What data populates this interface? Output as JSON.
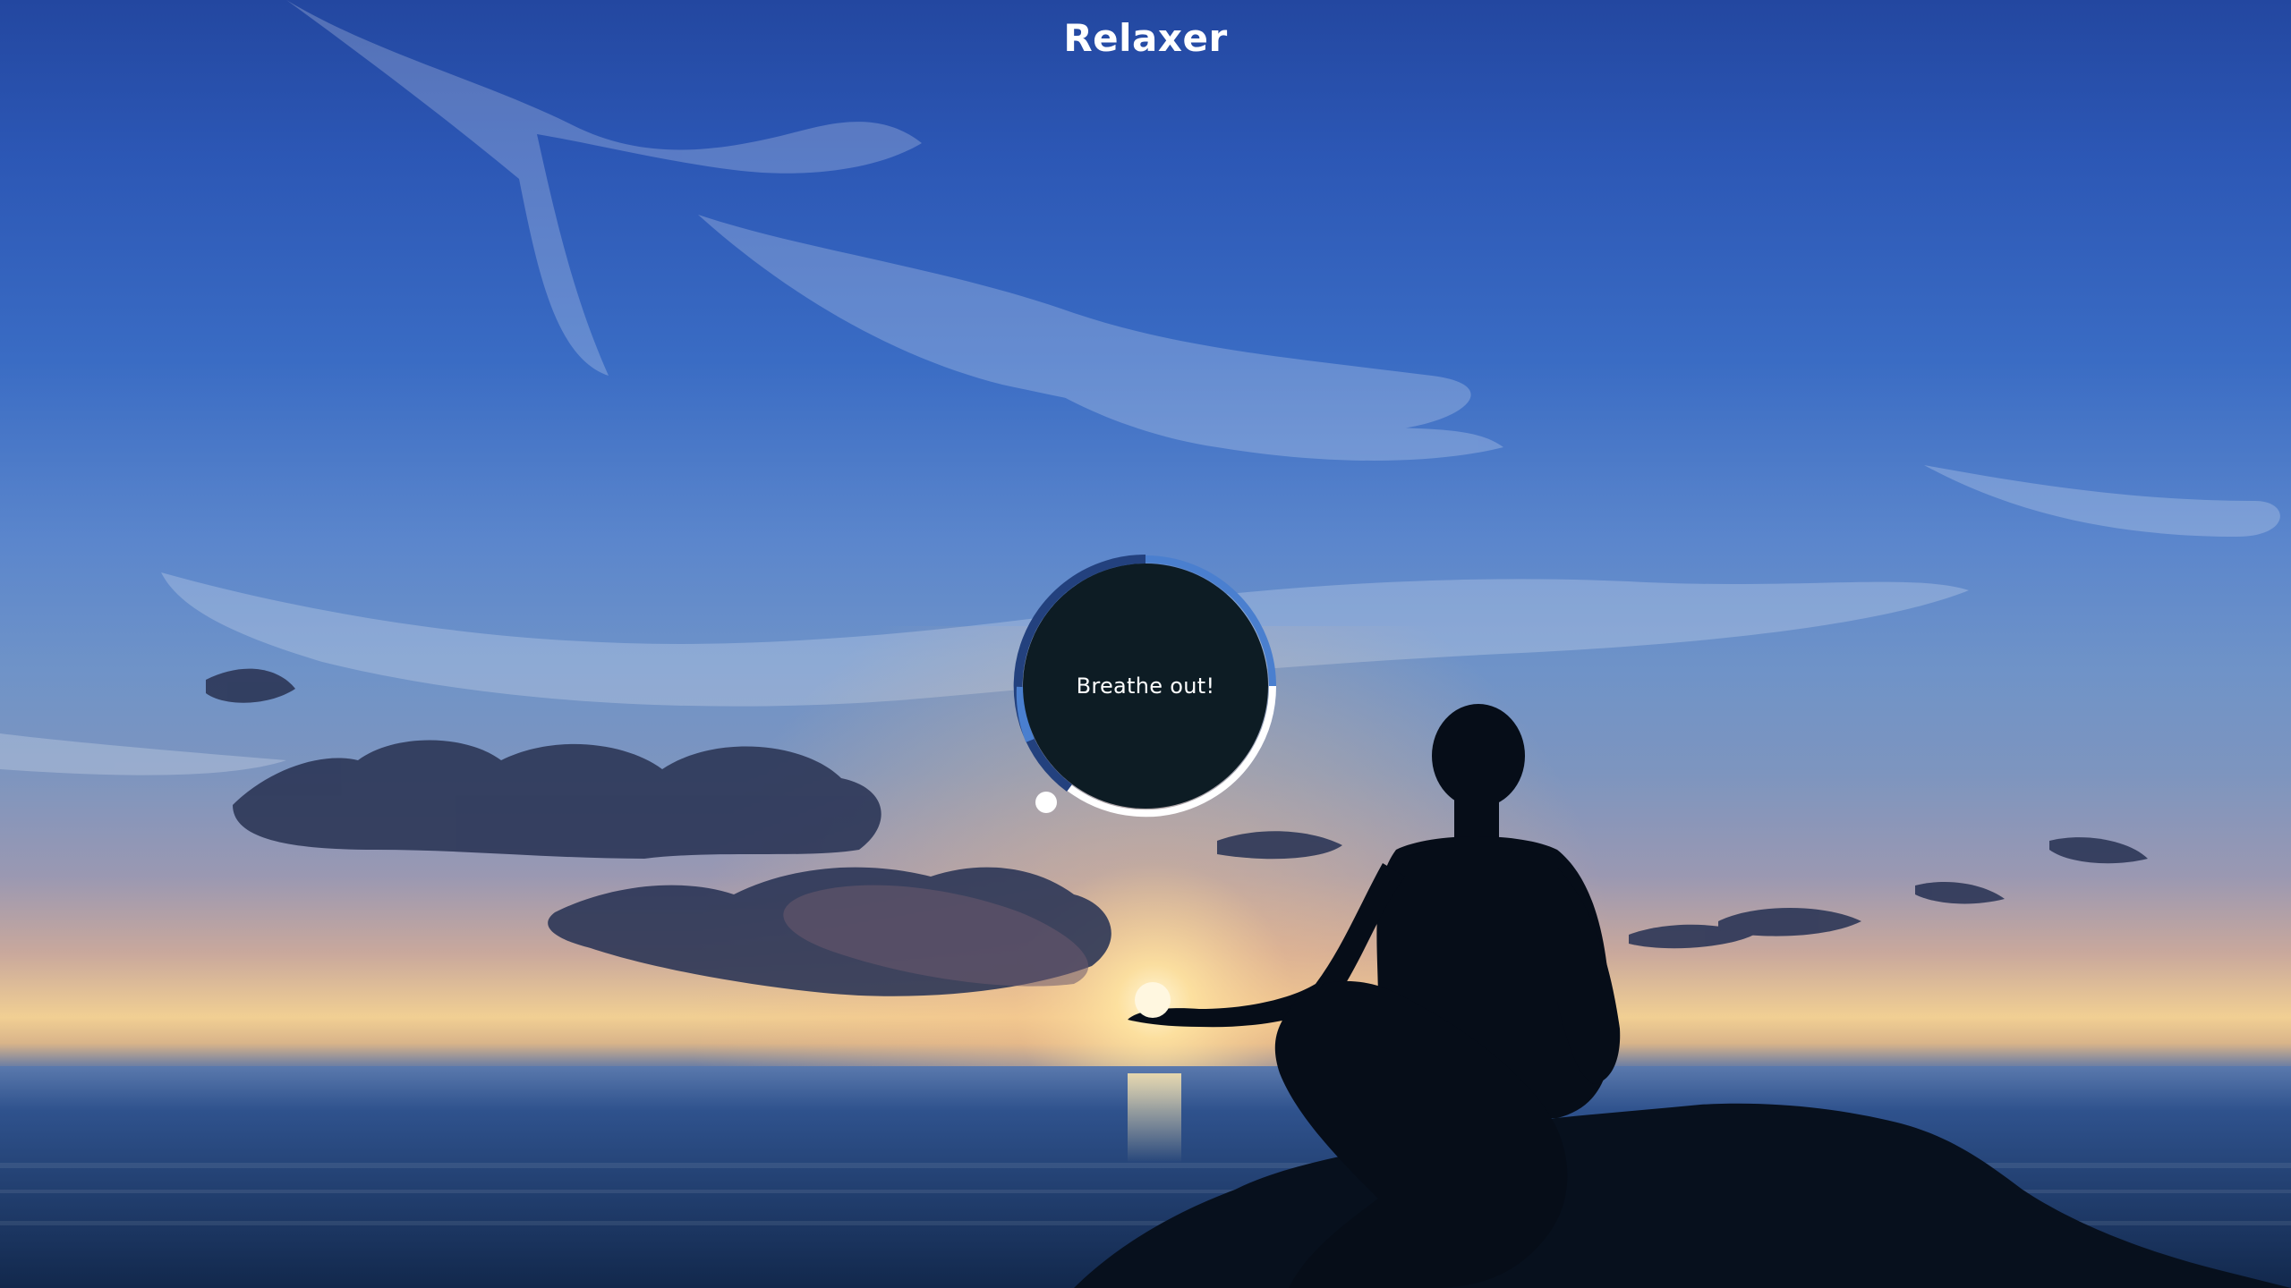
{
  "app": {
    "title": "Relaxer"
  },
  "breathing": {
    "instruction": "Breathe out!",
    "phase_progress": 0.58
  },
  "colors": {
    "ring_blue": "#4a7fcf",
    "ring_dark_blue": "#23417e",
    "ring_white": "#ffffff",
    "circle_fill": "#0d1c24",
    "text": "#ffffff"
  },
  "background": {
    "scene": "meditating-person-on-rock-at-sunset-over-ocean"
  }
}
